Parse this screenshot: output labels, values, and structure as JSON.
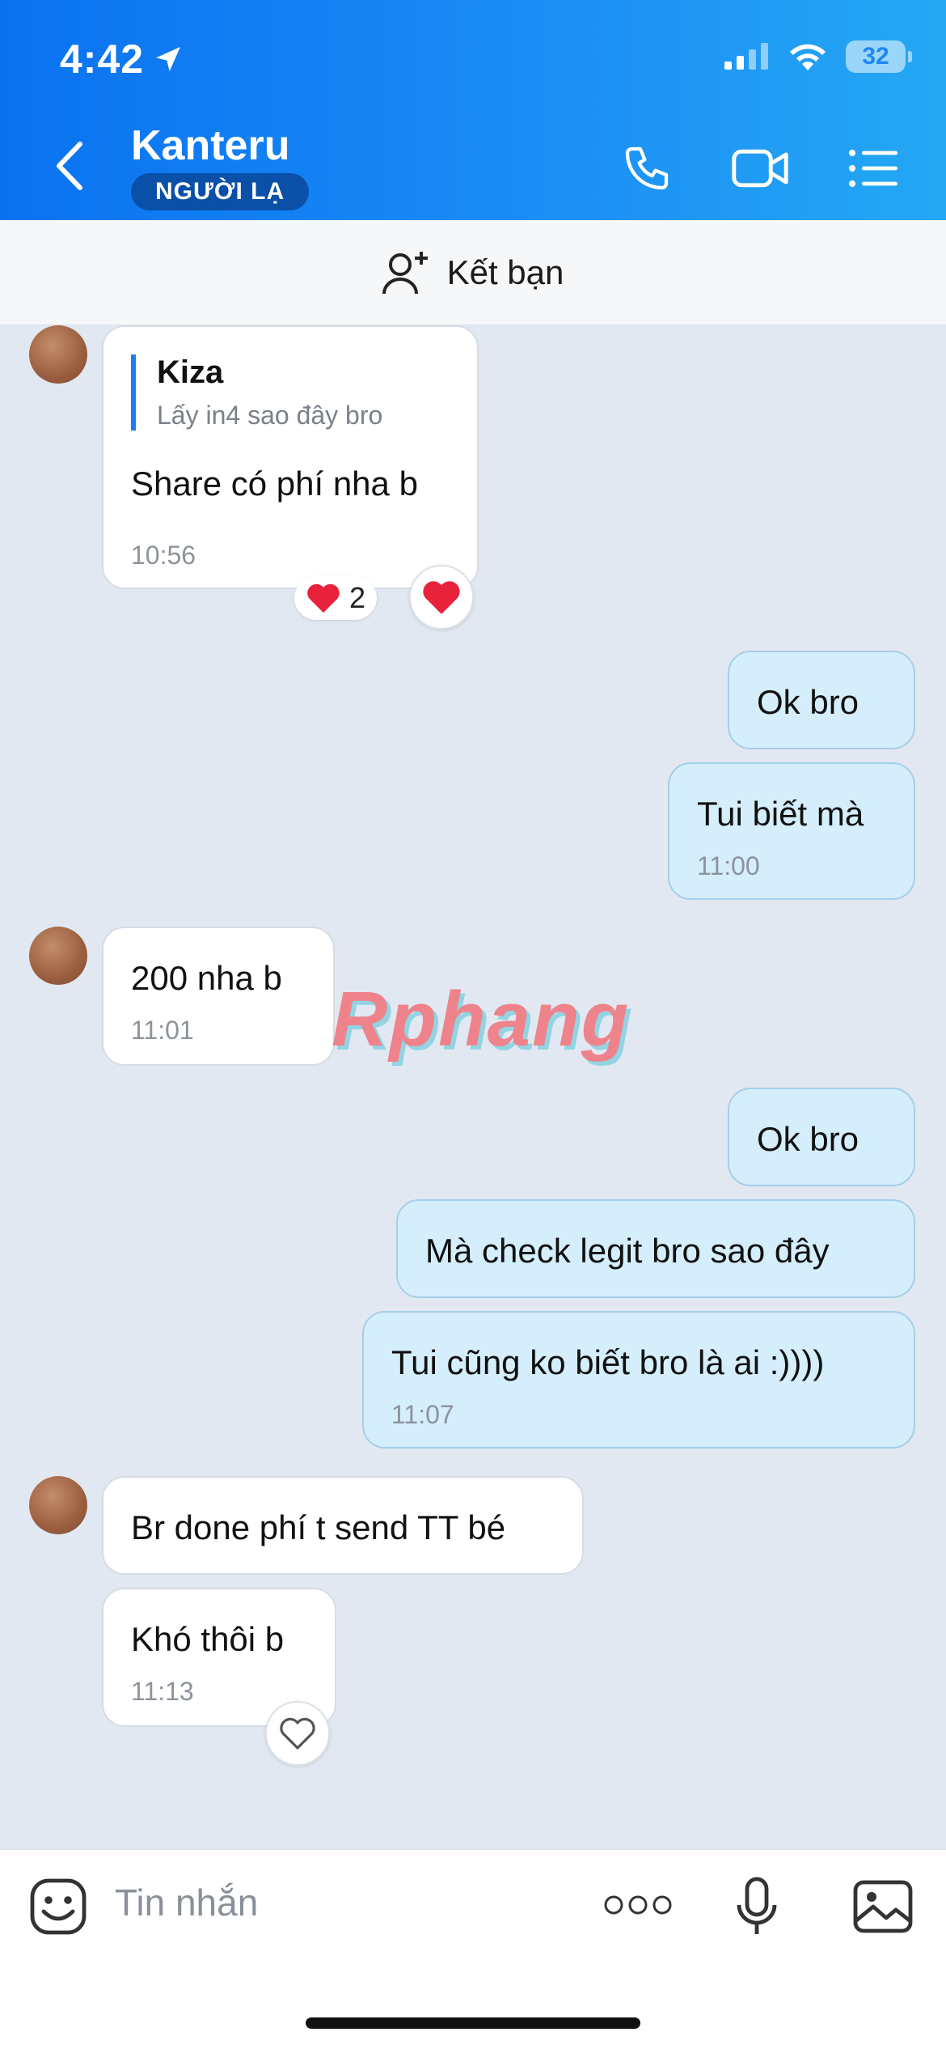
{
  "status_bar": {
    "time": "4:42",
    "battery": "32"
  },
  "header": {
    "name": "Kanteru",
    "badge": "NGƯỜI LẠ"
  },
  "add_friend": {
    "label": "Kết bạn"
  },
  "messages": [
    {
      "quote_name": "Kiza",
      "quote_text": "Lấy in4 sao đây bro",
      "text": "Share có phí nha b",
      "time": "10:56",
      "reaction_count": "2"
    },
    {
      "text": "Ok bro"
    },
    {
      "text": "Tui biết mà",
      "time": "11:00"
    },
    {
      "text": "200 nha b",
      "time": "11:01"
    },
    {
      "text": "Ok bro"
    },
    {
      "text": "Mà check legit bro sao đây"
    },
    {
      "text": "Tui cũng ko biết bro là ai :))))",
      "time": "11:07"
    },
    {
      "text": "Br done phí t send TT bé"
    },
    {
      "text": "Khó thôi b",
      "time": "11:13"
    }
  ],
  "watermark": "Rphang",
  "composer": {
    "placeholder": "Tin nhắn"
  },
  "colors": {
    "header_start": "#0a72f0",
    "header_end": "#24a8f4",
    "outgoing_bubble": "#d5eefc",
    "incoming_bubble": "#ffffff",
    "chat_background": "#e2e8f1",
    "quote_bar": "#1f7cf1"
  },
  "icons": [
    "location-arrow-icon",
    "signal-icon",
    "wifi-icon",
    "battery-icon",
    "back-icon",
    "phone-icon",
    "video-icon",
    "menu-list-icon",
    "add-user-icon",
    "heart-icon",
    "heart-outline-icon",
    "sticker-icon",
    "more-icon",
    "microphone-icon",
    "image-icon"
  ]
}
